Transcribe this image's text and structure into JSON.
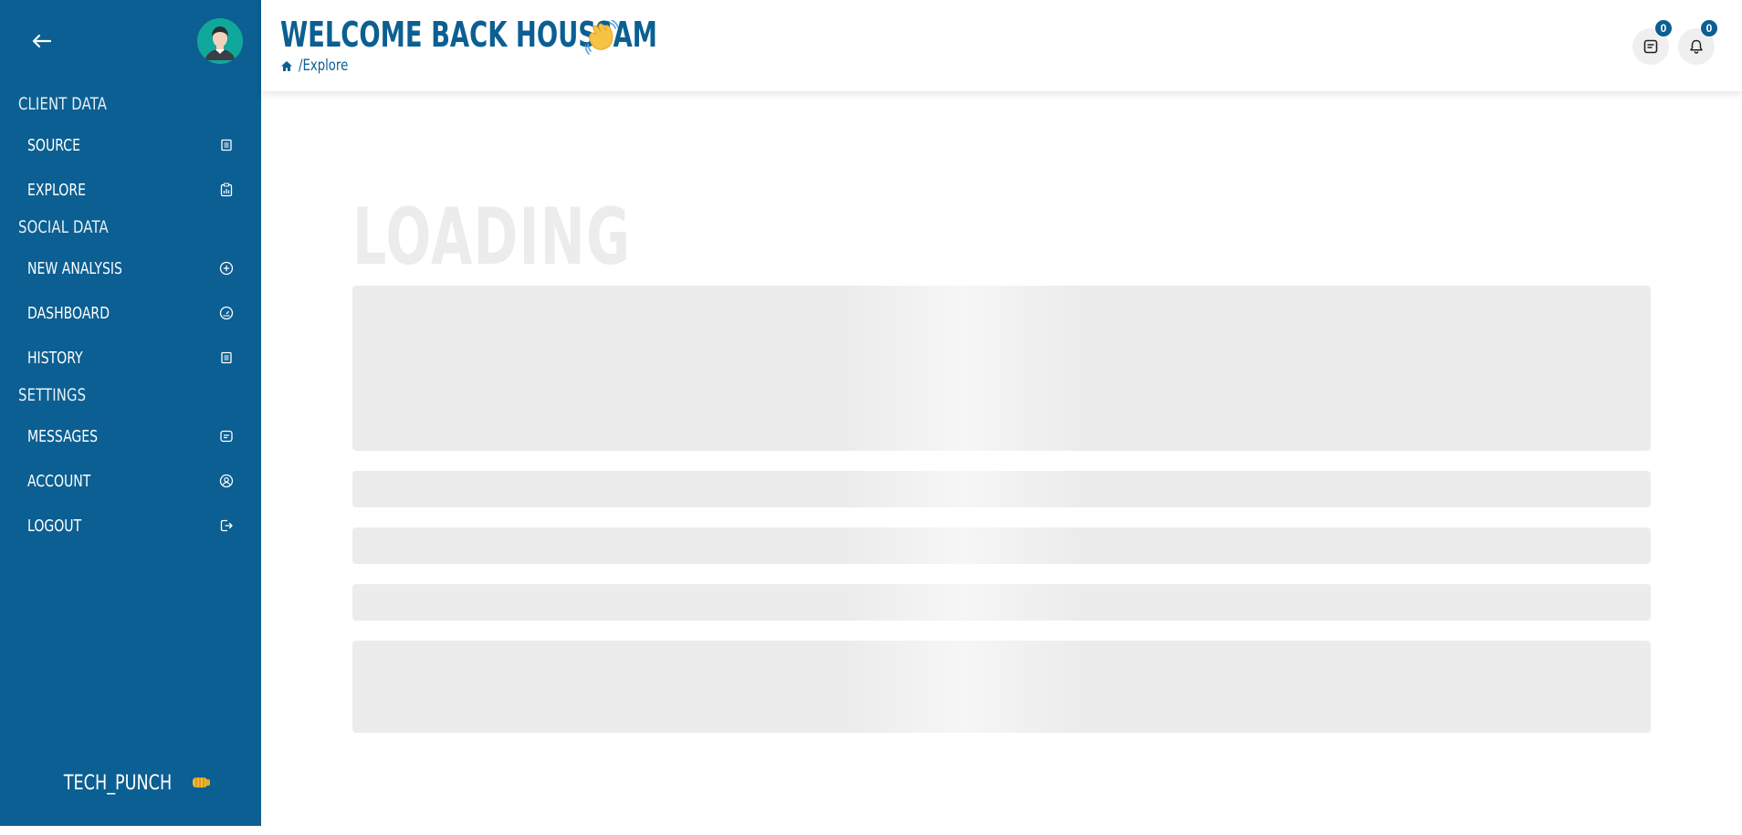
{
  "header": {
    "welcome": "WELCOME BACK HOUSSAM",
    "breadcrumb": "/Explore",
    "messages_count": "0",
    "notifications_count": "0"
  },
  "sidebar": {
    "sections": [
      {
        "title": "CLIENT DATA",
        "items": [
          {
            "label": "SOURCE",
            "icon": "list-icon"
          },
          {
            "label": "EXPLORE",
            "icon": "clipboard-chart-icon"
          }
        ]
      },
      {
        "title": "SOCIAL DATA",
        "items": [
          {
            "label": "NEW ANALYSIS",
            "icon": "plus-circle-icon"
          },
          {
            "label": "DASHBOARD",
            "icon": "gauge-icon"
          },
          {
            "label": "HISTORY",
            "icon": "list-icon"
          }
        ]
      },
      {
        "title": "SETTINGS",
        "items": [
          {
            "label": "MESSAGES",
            "icon": "message-icon"
          },
          {
            "label": "ACCOUNT",
            "icon": "user-circle-icon"
          },
          {
            "label": "LOGOUT",
            "icon": "logout-icon"
          }
        ]
      }
    ],
    "brand": "TECH_PUNCH"
  },
  "content": {
    "loading_title": "LOADING"
  },
  "colors": {
    "primary": "#0b5f92",
    "skeleton": "#ececec",
    "background": "#ffffff"
  }
}
